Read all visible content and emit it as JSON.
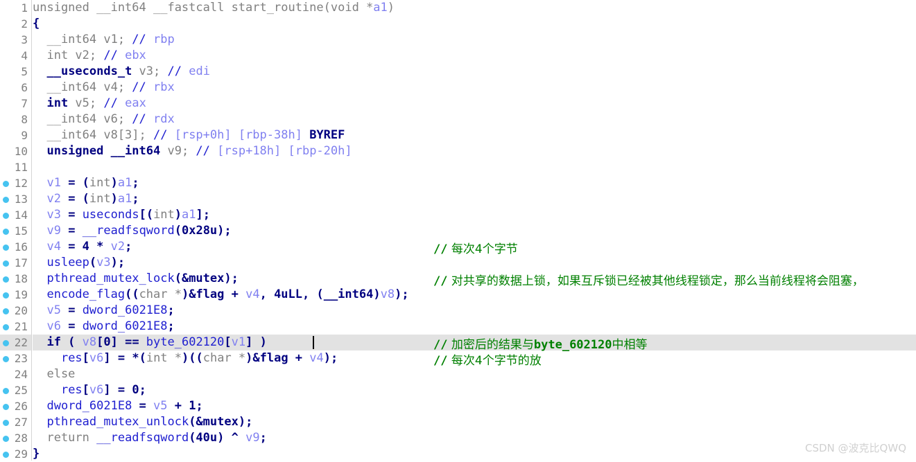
{
  "editor": {
    "kind": "ida-pseudocode-view",
    "highlighted_line": 22,
    "caret_line": 22,
    "breakpoint_marker_color": "#46c3f0",
    "highlight_color": "#e2e2e2",
    "colors": {
      "plain": "#808080",
      "keyword": "#000080",
      "function": "#2020d0",
      "variable": "#8080f0",
      "comment_register": "#8080f0",
      "comment_user": "#008000",
      "background": "#ffffff",
      "gutter_border": "#d4d4d4"
    }
  },
  "lines": [
    {
      "num": "1",
      "dot": false,
      "text": "unsigned __int64 __fastcall start_routine(void *a1)"
    },
    {
      "num": "2",
      "dot": false,
      "text": "{"
    },
    {
      "num": "3",
      "dot": false,
      "text": "  __int64 v1; // rbp"
    },
    {
      "num": "4",
      "dot": false,
      "text": "  int v2; // ebx"
    },
    {
      "num": "5",
      "dot": false,
      "text": "  __useconds_t v3; // edi"
    },
    {
      "num": "6",
      "dot": false,
      "text": "  __int64 v4; // rbx"
    },
    {
      "num": "7",
      "dot": false,
      "text": "  int v5; // eax"
    },
    {
      "num": "8",
      "dot": false,
      "text": "  __int64 v6; // rdx"
    },
    {
      "num": "9",
      "dot": false,
      "text": "  __int64 v8[3]; // [rsp+0h] [rbp-38h] BYREF"
    },
    {
      "num": "10",
      "dot": false,
      "text": "  unsigned __int64 v9; // [rsp+18h] [rbp-20h]"
    },
    {
      "num": "11",
      "dot": false,
      "text": ""
    },
    {
      "num": "12",
      "dot": true,
      "text": "  v1 = (int)a1;"
    },
    {
      "num": "13",
      "dot": true,
      "text": "  v2 = (int)a1;"
    },
    {
      "num": "14",
      "dot": true,
      "text": "  v3 = useconds[(int)a1];"
    },
    {
      "num": "15",
      "dot": true,
      "text": "  v9 = __readfsqword(0x28u);"
    },
    {
      "num": "16",
      "dot": true,
      "text": "  v4 = 4 * v2;"
    },
    {
      "num": "17",
      "dot": true,
      "text": "  usleep(v3);"
    },
    {
      "num": "18",
      "dot": true,
      "text": "  pthread_mutex_lock(&mutex);"
    },
    {
      "num": "19",
      "dot": true,
      "text": "  encode_flag((char *)&flag + v4, 4uLL, (__int64)v8);"
    },
    {
      "num": "20",
      "dot": true,
      "text": "  v5 = dword_6021E8;"
    },
    {
      "num": "21",
      "dot": true,
      "text": "  v6 = dword_6021E8;"
    },
    {
      "num": "22",
      "dot": true,
      "text": "  if ( v8[0] == byte_602120[v1] )"
    },
    {
      "num": "23",
      "dot": true,
      "text": "    res[v6] = *(int *)((char *)&flag + v4);"
    },
    {
      "num": "24",
      "dot": false,
      "text": "  else"
    },
    {
      "num": "25",
      "dot": true,
      "text": "    res[v6] = 0;"
    },
    {
      "num": "26",
      "dot": true,
      "text": "  dword_6021E8 = v5 + 1;"
    },
    {
      "num": "27",
      "dot": true,
      "text": "  pthread_mutex_unlock(&mutex);"
    },
    {
      "num": "28",
      "dot": true,
      "text": "  return __readfsqword(40u) ^ v9;"
    },
    {
      "num": "29",
      "dot": true,
      "text": "}"
    }
  ],
  "comments": [
    {
      "line": 16,
      "marker": "//",
      "text": "每次4个字节"
    },
    {
      "line": 18,
      "marker": "//",
      "text": "对共享的数据上锁，如果互斥锁已经被其他线程锁定，那么当前线程将会阻塞，"
    },
    {
      "line": 22,
      "marker": "//",
      "text_before": "加密后的结果与",
      "identifier": "byte_602120",
      "text_after": "中相等"
    },
    {
      "line": 23,
      "marker": "//",
      "text": "每次4个字节的放"
    }
  ],
  "watermark": {
    "text": "CSDN @波克比QWQ"
  }
}
